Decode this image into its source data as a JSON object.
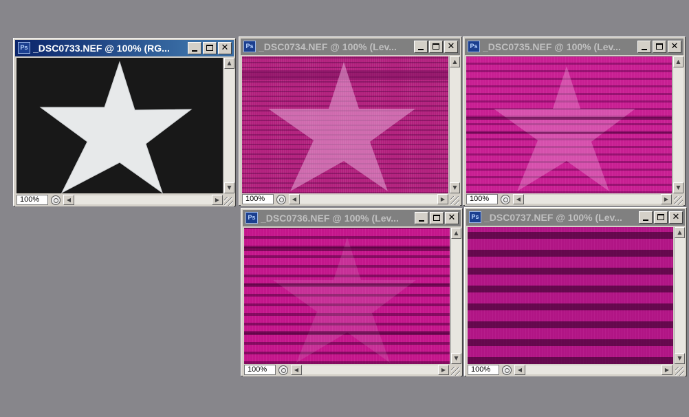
{
  "windows": [
    {
      "id": "dsc0733",
      "title": "_DSC0733.NEF @ 100% (RG...",
      "zoom": "100%",
      "state": "active"
    },
    {
      "id": "dsc0734",
      "title": "_DSC0734.NEF @ 100% (Lev...",
      "zoom": "100%",
      "state": "inactive"
    },
    {
      "id": "dsc0735",
      "title": "_DSC0735.NEF @ 100% (Lev...",
      "zoom": "100%",
      "state": "inactive"
    },
    {
      "id": "dsc0736",
      "title": "_DSC0736.NEF @ 100% (Lev...",
      "zoom": "100%",
      "state": "inactive"
    },
    {
      "id": "dsc0737",
      "title": "_DSC0737.NEF @ 100% (Lev...",
      "zoom": "100%",
      "state": "inactive"
    }
  ],
  "app_icon": "Ps",
  "icons": {
    "app": "photoshop-document-icon",
    "minimize": "minimize-icon",
    "maximize": "maximize-icon",
    "close": "close-icon",
    "info": "document-info-icon",
    "resize": "resize-grip-icon"
  },
  "colors": {
    "desktop": "#87868b",
    "active_title": "#0a246a",
    "inactive_title": "#808080",
    "star_light": "#e6e6e6",
    "noise_magenta": "#c81f92"
  }
}
